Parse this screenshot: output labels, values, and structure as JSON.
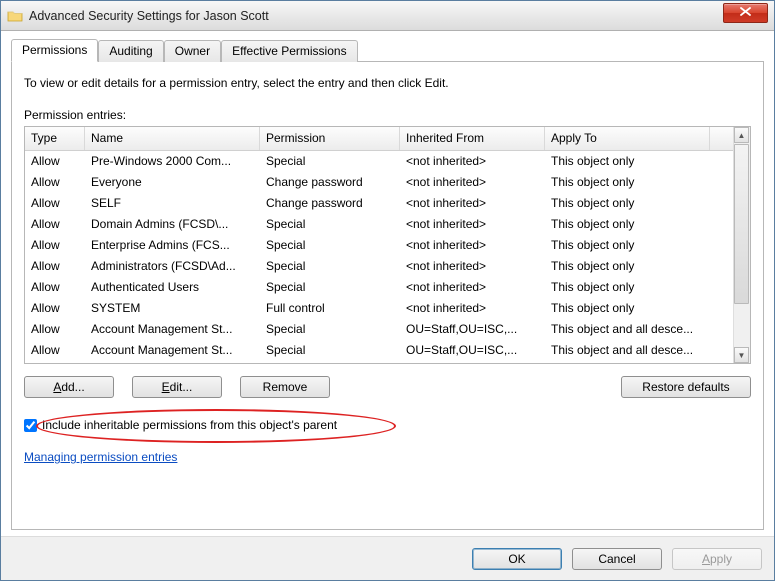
{
  "window": {
    "title": "Advanced Security Settings for Jason Scott",
    "close_tooltip": "Close"
  },
  "tabs": [
    {
      "label": "Permissions",
      "active": true
    },
    {
      "label": "Auditing",
      "active": false
    },
    {
      "label": "Owner",
      "active": false
    },
    {
      "label": "Effective Permissions",
      "active": false
    }
  ],
  "page": {
    "instruction": "To view or edit details for a permission entry, select the entry and then click Edit.",
    "entries_label": "Permission entries:",
    "columns": {
      "type": "Type",
      "name": "Name",
      "permission": "Permission",
      "inherited": "Inherited From",
      "apply": "Apply To"
    },
    "rows": [
      {
        "type": "Allow",
        "name": "Pre-Windows 2000 Com...",
        "permission": "Special",
        "inherited": "<not inherited>",
        "apply": "This object only"
      },
      {
        "type": "Allow",
        "name": "Everyone",
        "permission": "Change password",
        "inherited": "<not inherited>",
        "apply": "This object only"
      },
      {
        "type": "Allow",
        "name": "SELF",
        "permission": "Change password",
        "inherited": "<not inherited>",
        "apply": "This object only"
      },
      {
        "type": "Allow",
        "name": "Domain Admins (FCSD\\...",
        "permission": "Special",
        "inherited": "<not inherited>",
        "apply": "This object only"
      },
      {
        "type": "Allow",
        "name": "Enterprise Admins (FCS...",
        "permission": "Special",
        "inherited": "<not inherited>",
        "apply": "This object only"
      },
      {
        "type": "Allow",
        "name": "Administrators (FCSD\\Ad...",
        "permission": "Special",
        "inherited": "<not inherited>",
        "apply": "This object only"
      },
      {
        "type": "Allow",
        "name": "Authenticated Users",
        "permission": "Special",
        "inherited": "<not inherited>",
        "apply": "This object only"
      },
      {
        "type": "Allow",
        "name": "SYSTEM",
        "permission": "Full control",
        "inherited": "<not inherited>",
        "apply": "This object only"
      },
      {
        "type": "Allow",
        "name": "Account Management St...",
        "permission": "Special",
        "inherited": "OU=Staff,OU=ISC,...",
        "apply": "This object and all desce..."
      },
      {
        "type": "Allow",
        "name": "Account Management St...",
        "permission": "Special",
        "inherited": "OU=Staff,OU=ISC,...",
        "apply": "This object and all desce..."
      }
    ],
    "buttons": {
      "add": "Add...",
      "edit": "Edit...",
      "remove": "Remove",
      "restore": "Restore defaults"
    },
    "checkbox": {
      "checked": true,
      "label": "Include inheritable permissions from this object's parent"
    },
    "link": "Managing permission entries"
  },
  "footer": {
    "ok": "OK",
    "cancel": "Cancel",
    "apply": "Apply"
  }
}
